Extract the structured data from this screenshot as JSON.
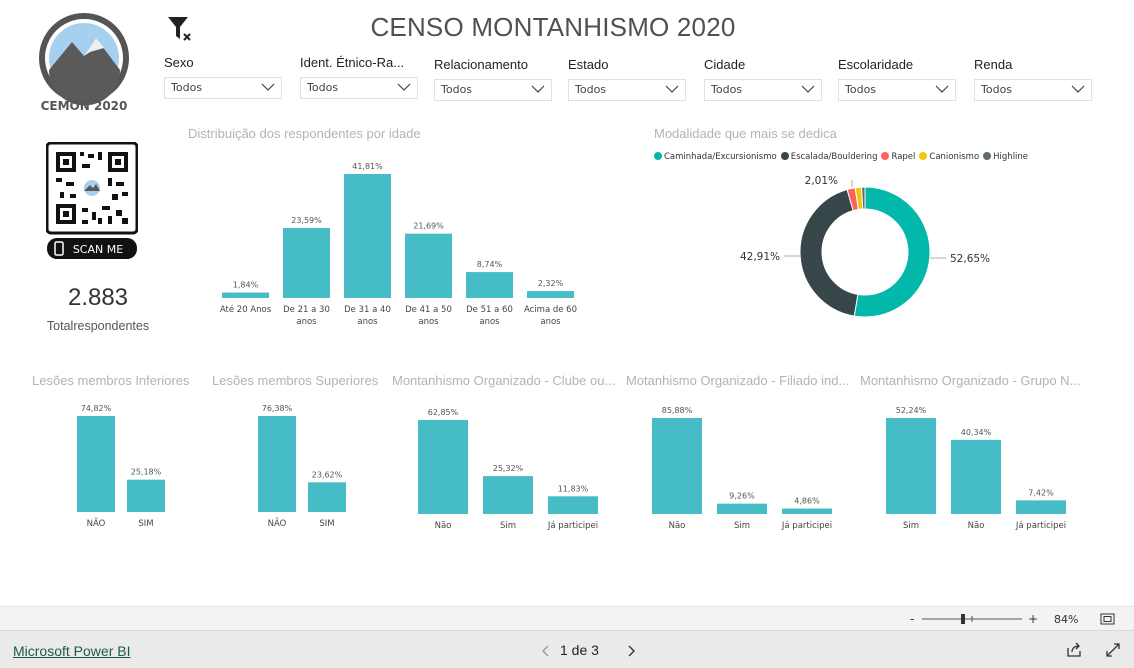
{
  "title": "CENSO MONTANHISMO 2020",
  "logo_text": "CEMON 2020",
  "qr_label": "SCAN ME",
  "filters": [
    {
      "label": "Sexo",
      "value": "Todos"
    },
    {
      "label": "Ident. Étnico-Ra...",
      "value": "Todos"
    },
    {
      "label": "Relacionamento",
      "value": "Todos"
    },
    {
      "label": "Estado",
      "value": "Todos"
    },
    {
      "label": "Cidade",
      "value": "Todos"
    },
    {
      "label": "Escolaridade",
      "value": "Todos"
    },
    {
      "label": "Renda",
      "value": "Todos"
    }
  ],
  "kpi": {
    "value": "2.883",
    "label": "Totalrespondentes"
  },
  "colors": {
    "bar": "#45bcc6",
    "teal": "#01b8aa",
    "dark": "#374649",
    "rapel": "#fd625e",
    "canionismo": "#f2c80f",
    "highline": "#5f6b6d"
  },
  "chart_data": [
    {
      "id": "age",
      "type": "bar",
      "title": "Distribuição dos respondentes por idade",
      "categories": [
        [
          "Até 20 Anos"
        ],
        [
          "De 21 a 30",
          "anos"
        ],
        [
          "De 31 a 40",
          "anos"
        ],
        [
          "De 41 a 50",
          "anos"
        ],
        [
          "De 51 a 60",
          "anos"
        ],
        [
          "Acima de 60",
          "anos"
        ]
      ],
      "values": [
        1.84,
        23.59,
        41.81,
        21.69,
        8.74,
        2.32
      ],
      "labels": [
        "1,84%",
        "23,59%",
        "41,81%",
        "21,69%",
        "8,74%",
        "2,32%"
      ]
    },
    {
      "id": "modality",
      "type": "pie",
      "title": "Modalidade que mais se dedica",
      "categories": [
        "Caminhada/Excursionismo",
        "Escalada/Bouldering",
        "Rapel",
        "Canionismo",
        "Highline"
      ],
      "values": [
        52.65,
        42.91,
        2.01,
        1.6,
        0.83
      ],
      "labels": [
        "52,65%",
        "42,91%",
        "2,01%",
        "",
        ""
      ],
      "legend": "top"
    },
    {
      "id": "inf",
      "type": "bar",
      "title": "Lesões membros Inferiores",
      "categories": [
        [
          "NÃO"
        ],
        [
          "SIM"
        ]
      ],
      "values": [
        74.82,
        25.18
      ],
      "labels": [
        "74,82%",
        "25,18%"
      ]
    },
    {
      "id": "sup",
      "type": "bar",
      "title": "Lesões membros Superiores",
      "categories": [
        [
          "NÃO"
        ],
        [
          "SIM"
        ]
      ],
      "values": [
        76.38,
        23.62
      ],
      "labels": [
        "76,38%",
        "23,62%"
      ]
    },
    {
      "id": "clube",
      "type": "bar",
      "title": "Montanhismo Organizado - Clube ou...",
      "categories": [
        [
          "Não"
        ],
        [
          "Sim"
        ],
        [
          "Já participei"
        ]
      ],
      "values": [
        62.85,
        25.32,
        11.83
      ],
      "labels": [
        "62,85%",
        "25,32%",
        "11,83%"
      ]
    },
    {
      "id": "filiado",
      "type": "bar",
      "title": "Motanhismo Organizado - Filiado ind...",
      "categories": [
        [
          "Não"
        ],
        [
          "Sim"
        ],
        [
          "Já participei"
        ]
      ],
      "values": [
        85.88,
        9.26,
        4.86
      ],
      "labels": [
        "85,88%",
        "9,26%",
        "4,86%"
      ]
    },
    {
      "id": "grupo",
      "type": "bar",
      "title": "Montanhismo Organizado - Grupo N...",
      "categories": [
        [
          "Sim"
        ],
        [
          "Não"
        ],
        [
          "Já participei"
        ]
      ],
      "values": [
        52.24,
        40.34,
        7.42
      ],
      "labels": [
        "52,24%",
        "40,34%",
        "7,42%"
      ]
    }
  ],
  "footer": {
    "brand": "Microsoft Power BI",
    "page": "1 de 3",
    "zoom": "84%"
  }
}
